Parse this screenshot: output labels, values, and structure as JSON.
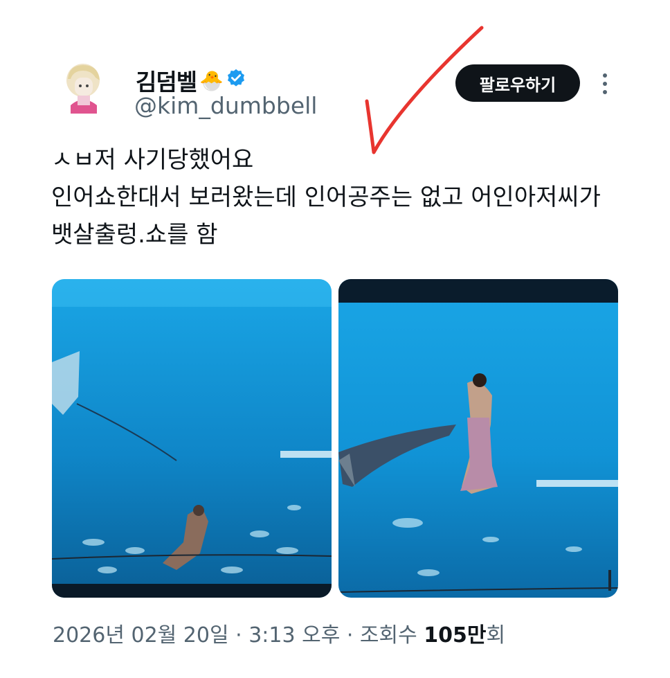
{
  "author": {
    "name": "김덤벨",
    "name_emoji": "🐣",
    "handle": "@kim_dumbbell",
    "verified": true,
    "verified_color": "#1d9bf0"
  },
  "actions": {
    "follow_label": "팔로우하기",
    "more_icon": "more-vertical-icon"
  },
  "tweet": {
    "text": "ㅅㅂ저 사기당했어요\n인어쇼한대서 보러왔는데 인어공주는 없고 어인아저씨가\n뱃살출렁.쇼를 함"
  },
  "meta": {
    "date": "2026년 02월 20일",
    "sep1": " · ",
    "time": "3:13 오후",
    "sep2": " · ",
    "views_label": "조회수 ",
    "views_num": "105만",
    "views_suffix": "회"
  },
  "annotation": {
    "color": "#e8352f",
    "icon": "checkmark-icon"
  },
  "colors": {
    "text": "#0f1419",
    "secondary": "#536471",
    "button_bg": "#0f1419",
    "water": "#1da2e0"
  }
}
